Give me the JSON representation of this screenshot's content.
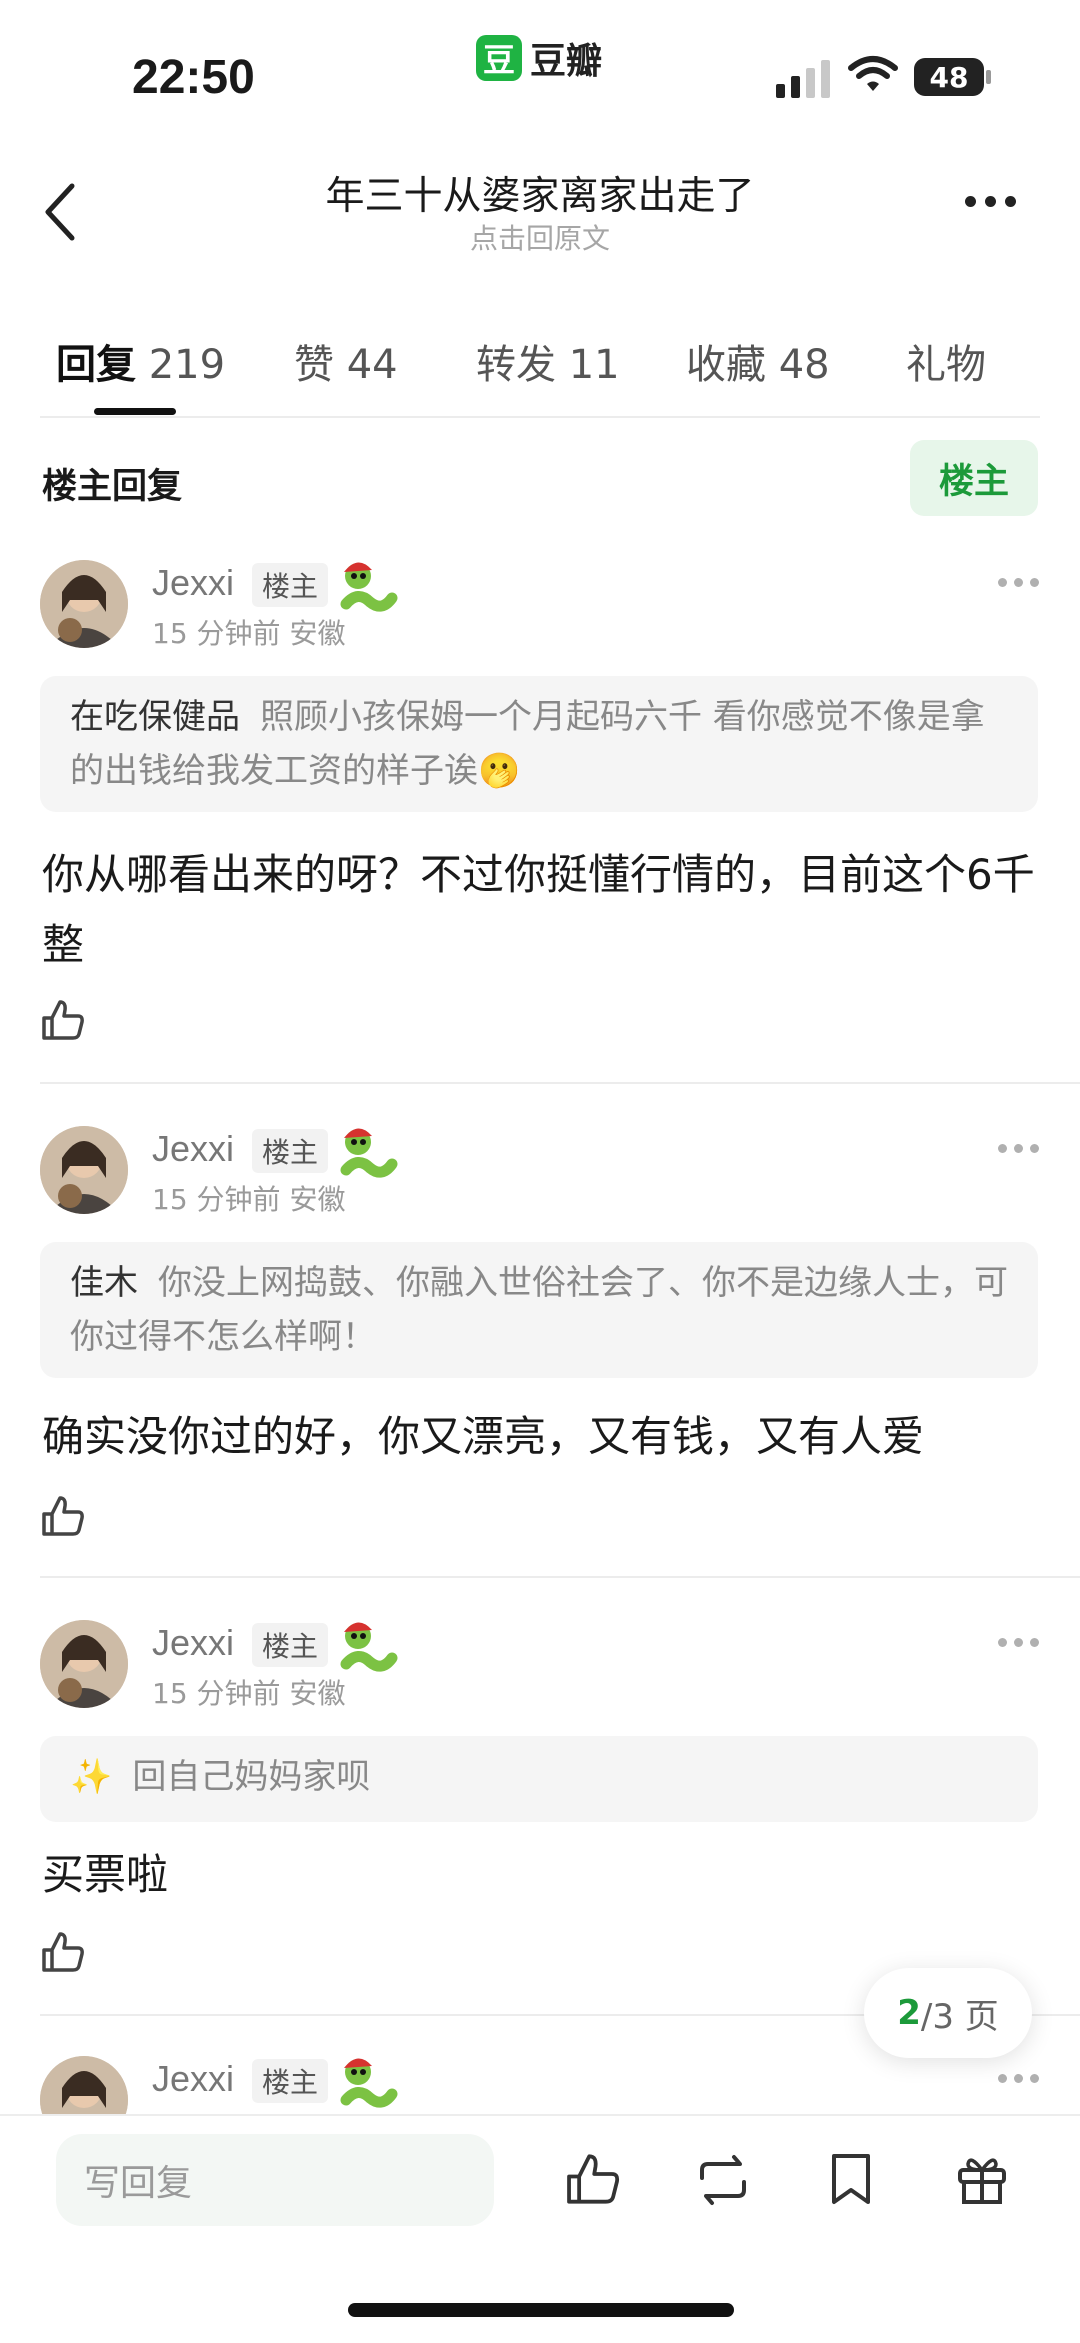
{
  "status_bar": {
    "time": "22:50",
    "battery": "48",
    "brand_logo": "豆",
    "brand_name": "豆瓣"
  },
  "header": {
    "title": "年三十从婆家离家出走了",
    "subtitle": "点击回原文"
  },
  "tabs": [
    {
      "label": "回复",
      "count": "219",
      "active": true
    },
    {
      "label": "赞",
      "count": "44"
    },
    {
      "label": "转发",
      "count": "11"
    },
    {
      "label": "收藏",
      "count": "48"
    },
    {
      "label": "礼物",
      "count": ""
    }
  ],
  "section": {
    "title": "楼主回复",
    "filter_button": "楼主"
  },
  "comments": [
    {
      "username": "Jexxi",
      "badge": "楼主",
      "time": "15 分钟前",
      "location": "安徽",
      "quote_name": "在吃保健品",
      "quote_text": "照顾小孩保姆一个月起码六千 看你感觉不像是拿的出钱给我发工资的样子诶🫢",
      "text": "你从哪看出来的呀？不过你挺懂行情的，目前这个6千整"
    },
    {
      "username": "Jexxi",
      "badge": "楼主",
      "time": "15 分钟前",
      "location": "安徽",
      "quote_name": "佳木",
      "quote_text": "你没上网捣鼓、你融入世俗社会了、你不是边缘人士，可你过得不怎么样啊！",
      "text": "确实没你过的好，你又漂亮，又有钱，又有人爱"
    },
    {
      "username": "Jexxi",
      "badge": "楼主",
      "time": "15 分钟前",
      "location": "安徽",
      "quote_name": "✨",
      "quote_text": "回自己妈妈家呗",
      "text": "买票啦"
    },
    {
      "username": "Jexxi",
      "badge": "楼主"
    }
  ],
  "pagination": {
    "current": "2",
    "total": "/3 页"
  },
  "bottom_bar": {
    "reply_placeholder": "写回复"
  },
  "colors": {
    "accent": "#1c9a3a",
    "brand": "#1fb343"
  }
}
